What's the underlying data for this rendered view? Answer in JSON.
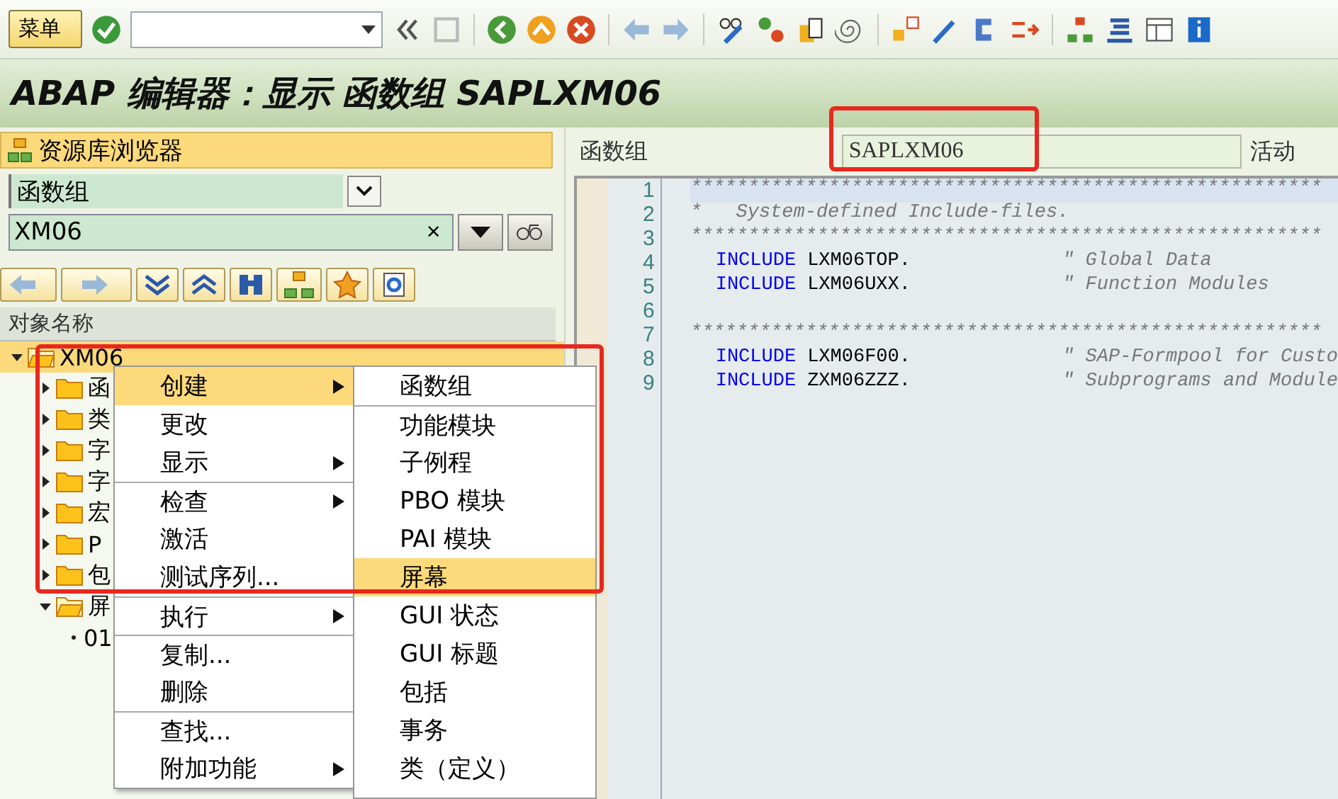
{
  "toolbar": {
    "menu_button": "菜单"
  },
  "title": "ABAP 编辑器：显示 函数组 SAPLXM06",
  "browser": {
    "title": "资源库浏览器",
    "object_type": "函数组",
    "object_name": "XM06",
    "clear": "×",
    "column_header": "对象名称",
    "tree": [
      {
        "label": "XM06",
        "expanded": true,
        "selected": true,
        "children": [
          {
            "label": "函",
            "expanded": false
          },
          {
            "label": "类",
            "expanded": false
          },
          {
            "label": "字",
            "expanded": false
          },
          {
            "label": "字",
            "expanded": false
          },
          {
            "label": "宏",
            "expanded": false
          },
          {
            "label": "P",
            "expanded": false
          },
          {
            "label": "包",
            "expanded": false
          },
          {
            "label": "屏",
            "expanded": true,
            "children": [
              {
                "label": "01"
              }
            ]
          }
        ]
      }
    ]
  },
  "editor": {
    "label": "函数组",
    "program": "SAPLXM06",
    "status": "活动",
    "lines": [
      {
        "number": "1",
        "kind": "comment",
        "text": "*******************************************************"
      },
      {
        "number": "2",
        "kind": "comment",
        "text": "*   System-defined Include-files."
      },
      {
        "number": "3",
        "kind": "comment",
        "text": "*******************************************************"
      },
      {
        "number": "4",
        "kind": "include",
        "keyword": "INCLUDE",
        "name": "LXM06TOP.",
        "comment": "\" Global Data"
      },
      {
        "number": "5",
        "kind": "include",
        "keyword": "INCLUDE",
        "name": "LXM06UXX.",
        "comment": "\" Function Modules"
      },
      {
        "number": "6",
        "kind": "blank"
      },
      {
        "number": "7",
        "kind": "comment",
        "text": "*******************************************************"
      },
      {
        "number": "8",
        "kind": "include",
        "keyword": "INCLUDE",
        "name": "LXM06F00.",
        "comment": "\" SAP-Formpool for Custo"
      },
      {
        "number": "9",
        "kind": "include",
        "keyword": "INCLUDE",
        "name": "ZXM06ZZZ.",
        "comment": "\" Subprograms and Module"
      }
    ]
  },
  "context_menu": [
    {
      "label": "创建",
      "submenu": true,
      "selected": true,
      "divider_before": false
    },
    {
      "label": "更改",
      "submenu": false,
      "selected": false,
      "divider_before": false
    },
    {
      "label": "显示",
      "submenu": true,
      "selected": false,
      "divider_before": false
    },
    {
      "label": "检查",
      "submenu": true,
      "selected": false,
      "divider_before": true
    },
    {
      "label": "激活",
      "submenu": false,
      "selected": false,
      "divider_before": false
    },
    {
      "label": "测试序列...",
      "submenu": false,
      "selected": false,
      "divider_before": false
    },
    {
      "label": "执行",
      "submenu": true,
      "selected": false,
      "divider_before": true
    },
    {
      "label": "复制...",
      "submenu": false,
      "selected": false,
      "divider_before": true
    },
    {
      "label": "删除",
      "submenu": false,
      "selected": false,
      "divider_before": false
    },
    {
      "label": "查找...",
      "submenu": false,
      "selected": false,
      "divider_before": true
    },
    {
      "label": "附加功能",
      "submenu": true,
      "selected": false,
      "divider_before": false
    }
  ],
  "submenu": [
    {
      "label": "函数组",
      "selected": false,
      "divider_before": false
    },
    {
      "label": "功能模块",
      "selected": false,
      "divider_before": true
    },
    {
      "label": "子例程",
      "selected": false,
      "divider_before": false
    },
    {
      "label": "PBO 模块",
      "selected": false,
      "divider_before": false
    },
    {
      "label": "PAI 模块",
      "selected": false,
      "divider_before": false
    },
    {
      "label": "屏幕",
      "selected": true,
      "divider_before": false
    },
    {
      "label": "GUI 状态",
      "selected": false,
      "divider_before": false
    },
    {
      "label": "GUI 标题",
      "selected": false,
      "divider_before": false
    },
    {
      "label": "包括",
      "selected": false,
      "divider_before": false
    },
    {
      "label": "事务",
      "selected": false,
      "divider_before": false
    },
    {
      "label": "类（定义）",
      "selected": false,
      "divider_before": false
    }
  ]
}
